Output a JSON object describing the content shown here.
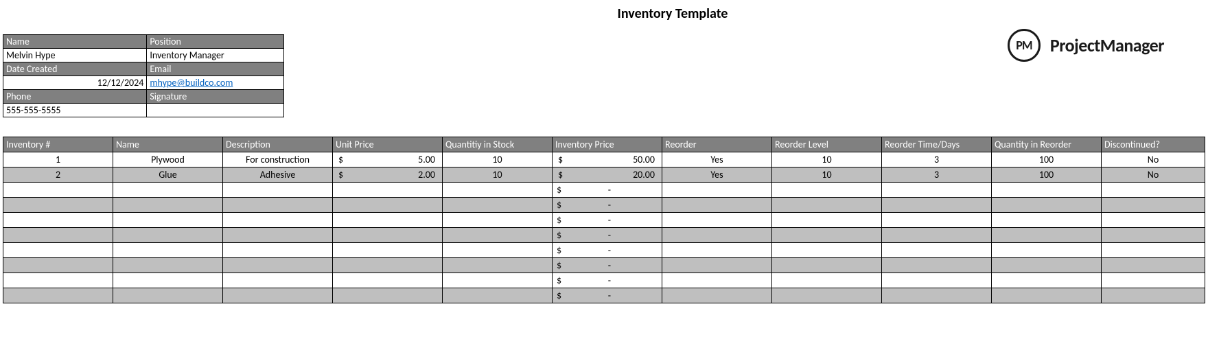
{
  "title": "Inventory Template",
  "brand": {
    "badge": "PM",
    "name": "ProjectManager"
  },
  "info": {
    "name_label": "Name",
    "name_value": "Melvin Hype",
    "position_label": "Position",
    "position_value": "Inventory Manager",
    "date_label": "Date Created",
    "date_value": "12/12/2024",
    "email_label": "Email",
    "email_value": "mhype@buildco.com",
    "phone_label": "Phone",
    "phone_value": "555-555-5555",
    "signature_label": "Signature",
    "signature_value": ""
  },
  "headers": {
    "c0": "Inventory #",
    "c1": "Name",
    "c2": "Description",
    "c3": "Unit Price",
    "c4": "Quantitiy in Stock",
    "c5": "Inventory Price",
    "c6": "Reorder",
    "c7": "Reorder Level",
    "c8": "Reorder Time/Days",
    "c9": "Quantity in Reorder",
    "c10": "Discontinued?"
  },
  "currency": "$",
  "dash": "-",
  "rows": [
    {
      "inv": "1",
      "name": "Plywood",
      "desc": "For construction",
      "unit": "5.00",
      "qty": "10",
      "invp": "50.00",
      "reorder": "Yes",
      "level": "10",
      "days": "3",
      "qreorder": "100",
      "disc": "No"
    },
    {
      "inv": "2",
      "name": "Glue",
      "desc": "Adhesive",
      "unit": "2.00",
      "qty": "10",
      "invp": "20.00",
      "reorder": "Yes",
      "level": "10",
      "days": "3",
      "qreorder": "100",
      "disc": "No"
    },
    {
      "inv": "",
      "name": "",
      "desc": "",
      "unit": "",
      "qty": "",
      "invp": "",
      "reorder": "",
      "level": "",
      "days": "",
      "qreorder": "",
      "disc": ""
    },
    {
      "inv": "",
      "name": "",
      "desc": "",
      "unit": "",
      "qty": "",
      "invp": "",
      "reorder": "",
      "level": "",
      "days": "",
      "qreorder": "",
      "disc": ""
    },
    {
      "inv": "",
      "name": "",
      "desc": "",
      "unit": "",
      "qty": "",
      "invp": "",
      "reorder": "",
      "level": "",
      "days": "",
      "qreorder": "",
      "disc": ""
    },
    {
      "inv": "",
      "name": "",
      "desc": "",
      "unit": "",
      "qty": "",
      "invp": "",
      "reorder": "",
      "level": "",
      "days": "",
      "qreorder": "",
      "disc": ""
    },
    {
      "inv": "",
      "name": "",
      "desc": "",
      "unit": "",
      "qty": "",
      "invp": "",
      "reorder": "",
      "level": "",
      "days": "",
      "qreorder": "",
      "disc": ""
    },
    {
      "inv": "",
      "name": "",
      "desc": "",
      "unit": "",
      "qty": "",
      "invp": "",
      "reorder": "",
      "level": "",
      "days": "",
      "qreorder": "",
      "disc": ""
    },
    {
      "inv": "",
      "name": "",
      "desc": "",
      "unit": "",
      "qty": "",
      "invp": "",
      "reorder": "",
      "level": "",
      "days": "",
      "qreorder": "",
      "disc": ""
    },
    {
      "inv": "",
      "name": "",
      "desc": "",
      "unit": "",
      "qty": "",
      "invp": "",
      "reorder": "",
      "level": "",
      "days": "",
      "qreorder": "",
      "disc": ""
    }
  ]
}
